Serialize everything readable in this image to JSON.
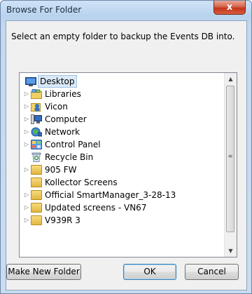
{
  "window": {
    "title": "Browse For Folder",
    "close_glyph": "x"
  },
  "dialog": {
    "instruction": "Select an empty folder to backup the Events DB into."
  },
  "tree": {
    "items": [
      {
        "label": "Desktop",
        "icon": "desktop-icon",
        "expander": "",
        "selected": true
      },
      {
        "label": "Libraries",
        "icon": "libraries-icon",
        "expander": "▷"
      },
      {
        "label": "Vicon",
        "icon": "user-folder-icon",
        "expander": "▷"
      },
      {
        "label": "Computer",
        "icon": "computer-icon",
        "expander": "▷"
      },
      {
        "label": "Network",
        "icon": "network-icon",
        "expander": "▷"
      },
      {
        "label": "Control Panel",
        "icon": "control-panel-icon",
        "expander": "▷"
      },
      {
        "label": "Recycle Bin",
        "icon": "recycle-bin-icon",
        "expander": ""
      },
      {
        "label": "905 FW",
        "icon": "folder-icon",
        "expander": "▷"
      },
      {
        "label": "Kollector Screens",
        "icon": "folder-icon",
        "expander": ""
      },
      {
        "label": "Official SmartManager_3-28-13",
        "icon": "folder-icon",
        "expander": "▷"
      },
      {
        "label": "Updated screens - VN67",
        "icon": "folder-icon",
        "expander": "▷"
      },
      {
        "label": "V939R 3",
        "icon": "folder-icon",
        "expander": "▷"
      }
    ]
  },
  "scrollbar": {
    "up": "▲",
    "down": "▼",
    "grip": "≡"
  },
  "buttons": {
    "make_new_folder": "Make New Folder",
    "ok": "OK",
    "cancel": "Cancel"
  },
  "colors": {
    "selection": "#dbe9f8",
    "close": "#c2361b",
    "frame": "#c3d9f1"
  }
}
